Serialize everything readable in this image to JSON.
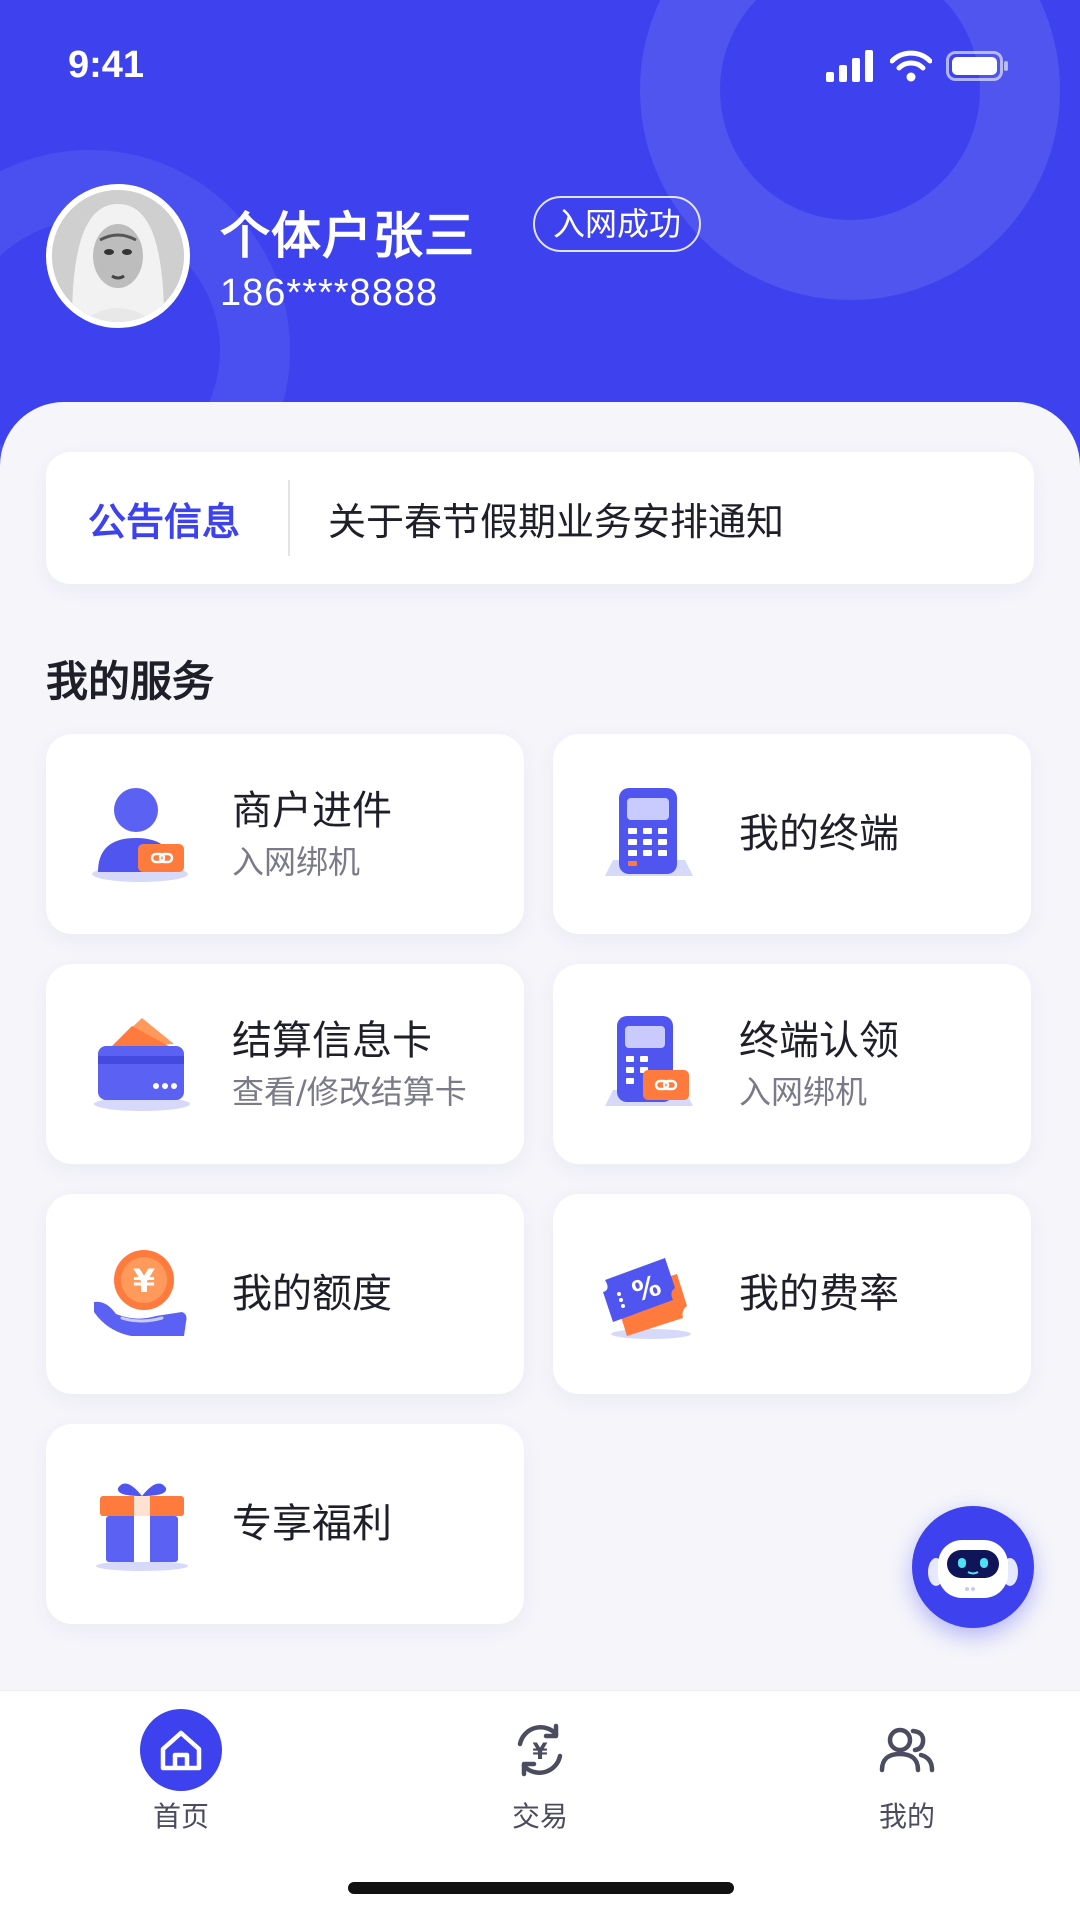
{
  "status_bar": {
    "time": "9:41"
  },
  "user": {
    "name": "个体户张三",
    "badge": "入网成功",
    "phone": "186****8888"
  },
  "notice": {
    "label": "公告信息",
    "text": "关于春节假期业务安排通知"
  },
  "services": {
    "title": "我的服务",
    "items": [
      {
        "title": "商户进件",
        "subtitle": "入网绑机",
        "icon": "merchant-icon"
      },
      {
        "title": "我的终端",
        "subtitle": "",
        "icon": "pos-terminal-icon"
      },
      {
        "title": "结算信息卡",
        "subtitle": "查看/修改结算卡",
        "icon": "settlement-card-icon"
      },
      {
        "title": "终端认领",
        "subtitle": "入网绑机",
        "icon": "terminal-claim-icon"
      },
      {
        "title": "我的额度",
        "subtitle": "",
        "icon": "credit-limit-icon"
      },
      {
        "title": "我的费率",
        "subtitle": "",
        "icon": "fee-rate-icon"
      },
      {
        "title": "专享福利",
        "subtitle": "",
        "icon": "gift-icon"
      }
    ]
  },
  "assistant": {
    "icon": "robot-assistant-icon"
  },
  "tabbar": {
    "items": [
      {
        "label": "首页",
        "icon": "home-icon",
        "active": true
      },
      {
        "label": "交易",
        "icon": "yuan-exchange-icon",
        "active": false
      },
      {
        "label": "我的",
        "icon": "users-icon",
        "active": false
      }
    ]
  },
  "colors": {
    "primary": "#3D42EE",
    "accent_orange": "#FF7A3D",
    "background": "#F5F5FA",
    "text_primary": "#1F1F2A",
    "text_secondary": "#7A7A88"
  }
}
